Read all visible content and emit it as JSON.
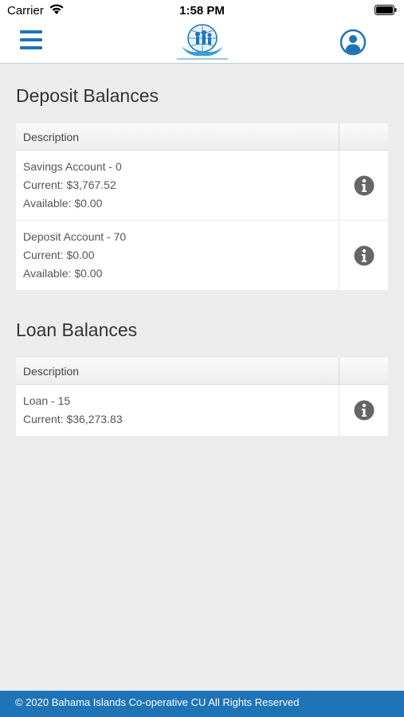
{
  "status_bar": {
    "carrier": "Carrier",
    "time": "1:58 PM"
  },
  "nav": {
    "menu_icon": "hamburger-icon",
    "logo_icon": "credit-union-logo",
    "profile_icon": "user-profile-icon"
  },
  "deposit": {
    "title": "Deposit Balances",
    "header_description": "Description",
    "rows": [
      {
        "name": "Savings Account - 0",
        "current": "Current: $3,767.52",
        "available": "Available: $0.00"
      },
      {
        "name": "Deposit Account - 70",
        "current": "Current: $0.00",
        "available": "Available: $0.00"
      }
    ]
  },
  "loan": {
    "title": "Loan Balances",
    "header_description": "Description",
    "rows": [
      {
        "name": "Loan - 15",
        "current": "Current: $36,273.83"
      }
    ]
  },
  "footer": {
    "text": "© 2020 Bahama Islands Co-operative CU All Rights Reserved"
  },
  "colors": {
    "brand_blue": "#1f74b8",
    "background": "#ececec",
    "info_icon": "#666666"
  }
}
